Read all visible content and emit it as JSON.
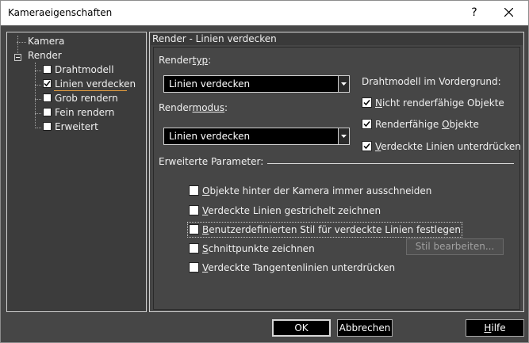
{
  "window": {
    "title": "Kameraeigenschaften",
    "help_glyph": "?"
  },
  "tree": {
    "items": [
      {
        "label": "Kamera"
      },
      {
        "label": "Render"
      },
      {
        "label": "Drahtmodell",
        "checked": false
      },
      {
        "label": "Linien verdecken",
        "checked": true,
        "selected": true
      },
      {
        "label": "Grob rendern",
        "checked": false
      },
      {
        "label": "Fein rendern",
        "checked": false
      },
      {
        "label": "Erweitert",
        "checked": false
      }
    ]
  },
  "panel": {
    "header": "Render - Linien verdecken",
    "rendertyp_label_a": "Render",
    "rendertyp_label_b": "typ",
    "rendertyp_label_c": ":",
    "rendertyp_value": "Linien verdecken",
    "rendermodus_label_a": "Render",
    "rendermodus_label_b": "modus",
    "rendermodus_label_c": ":",
    "rendermodus_value": "Linien verdecken",
    "vordergrund_label": "Drahtmodell im Vordergrund:",
    "vordergrund": [
      {
        "label_a": "",
        "label_u": "N",
        "label_b": "icht renderfähige Objekte",
        "checked": true
      },
      {
        "label_a": "Renderfähige ",
        "label_u": "O",
        "label_b": "bjekte",
        "checked": true
      },
      {
        "label_a": "",
        "label_u": "V",
        "label_b": "erdeckte Linien unterdrücken",
        "checked": true
      }
    ],
    "erweiterte_label": "Erweiterte Parameter:",
    "options": [
      {
        "label_a": "",
        "label_u": "O",
        "label_b": "bjekte hinter der Kamera immer ausschneiden",
        "checked": false
      },
      {
        "label_a": "",
        "label_u": "V",
        "label_b": "erdeckte Linien gestrichelt zeichnen",
        "checked": false
      },
      {
        "label_a": "",
        "label_u": "B",
        "label_b": "enutzerdefinierten Stil für verdeckte Linien festlegen",
        "checked": false
      },
      {
        "label_a": "",
        "label_u": "S",
        "label_b": "chnittpunkte zeichnen",
        "checked": false
      },
      {
        "label_a": "",
        "label_u": "V",
        "label_b": "erdeckte Tangentenlinien unterdrücken",
        "checked": false
      }
    ],
    "stil_button": "Stil bearbeiten..."
  },
  "buttons": {
    "ok": "OK",
    "cancel": "Abbrechen",
    "help_u": "H",
    "help_rest": "ilfe"
  },
  "colors": {
    "background": "#464646",
    "tree_background": "#3c3c3c",
    "combo_background": "#000000",
    "selection_underline": "#e8a040"
  }
}
